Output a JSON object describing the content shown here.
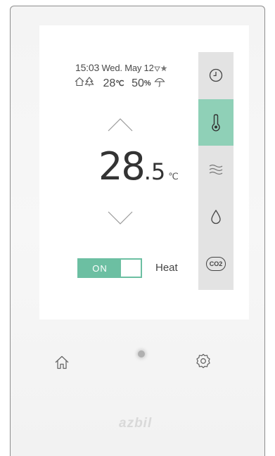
{
  "status": {
    "time": "15:03",
    "date": "Wed. May 12",
    "indoor_temp": "28",
    "indoor_temp_unit": "℃",
    "humidity": "50",
    "humidity_unit": "%"
  },
  "setpoint": {
    "integer": "28",
    "decimal": ".5",
    "unit": "℃"
  },
  "power": {
    "state_label": "ON",
    "mode_label": "Heat"
  },
  "rail": {
    "co2_label": "CO2",
    "active_item": "temperature"
  },
  "brand": {
    "name": "azbil"
  },
  "colors": {
    "accent": "#6cbfa2",
    "rail_active": "#8fd0b7",
    "rail_bg": "#e3e3e3"
  },
  "icons": [
    "flag-down-icon",
    "star-icon",
    "home-outline-icon",
    "tree-icon",
    "umbrella-icon",
    "chevron-up-icon",
    "chevron-down-icon",
    "clock-icon",
    "thermometer-icon",
    "airflow-icon",
    "water-drop-icon",
    "co2-icon",
    "home-icon",
    "gear-icon"
  ]
}
